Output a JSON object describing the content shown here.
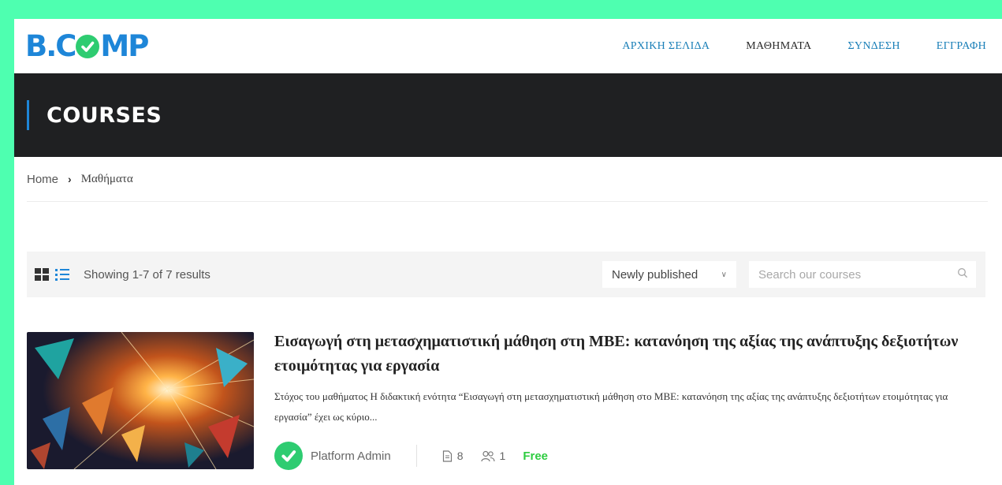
{
  "logo": {
    "left": "B.C",
    "right": "MP"
  },
  "nav": [
    {
      "label": "ΑΡΧΙΚΗ ΣΕΛΙΔΑ"
    },
    {
      "label": "ΜΑΘΗΜΑΤΑ"
    },
    {
      "label": "ΣΥΝΔΕΣΗ"
    },
    {
      "label": "ΕΓΓΡΑΦΗ"
    }
  ],
  "banner": {
    "title": "COURSES"
  },
  "breadcrumb": {
    "home": "Home",
    "current": "Μαθήματα"
  },
  "toolbar": {
    "results": "Showing 1-7 of 7 results",
    "sort_selected": "Newly published",
    "search_placeholder": "Search our courses"
  },
  "course": {
    "title": "Εισαγωγή στη μετασχηματιστική μάθηση στη ΜΒΕ: κατανόηση της αξίας της ανάπτυξης δεξιοτήτων ετοιμότητας για εργασία",
    "description": "Στόχος του μαθήματος Η διδακτική ενότητα “Εισαγωγή στη μετασχηματιστική μάθηση στο ΜΒΕ: κατανόηση της αξίας της ανάπτυξης δεξιοτήτων ετοιμότητας για εργασία” έχει ως κύριο...",
    "author": "Platform Admin",
    "lessons": "8",
    "students": "1",
    "price": "Free"
  },
  "colors": {
    "accent": "#1e86d8",
    "brand_green": "#2ecc71",
    "banner_bg": "#1f2022",
    "border_bg": "#4effb0",
    "price": "#2ecc40"
  }
}
